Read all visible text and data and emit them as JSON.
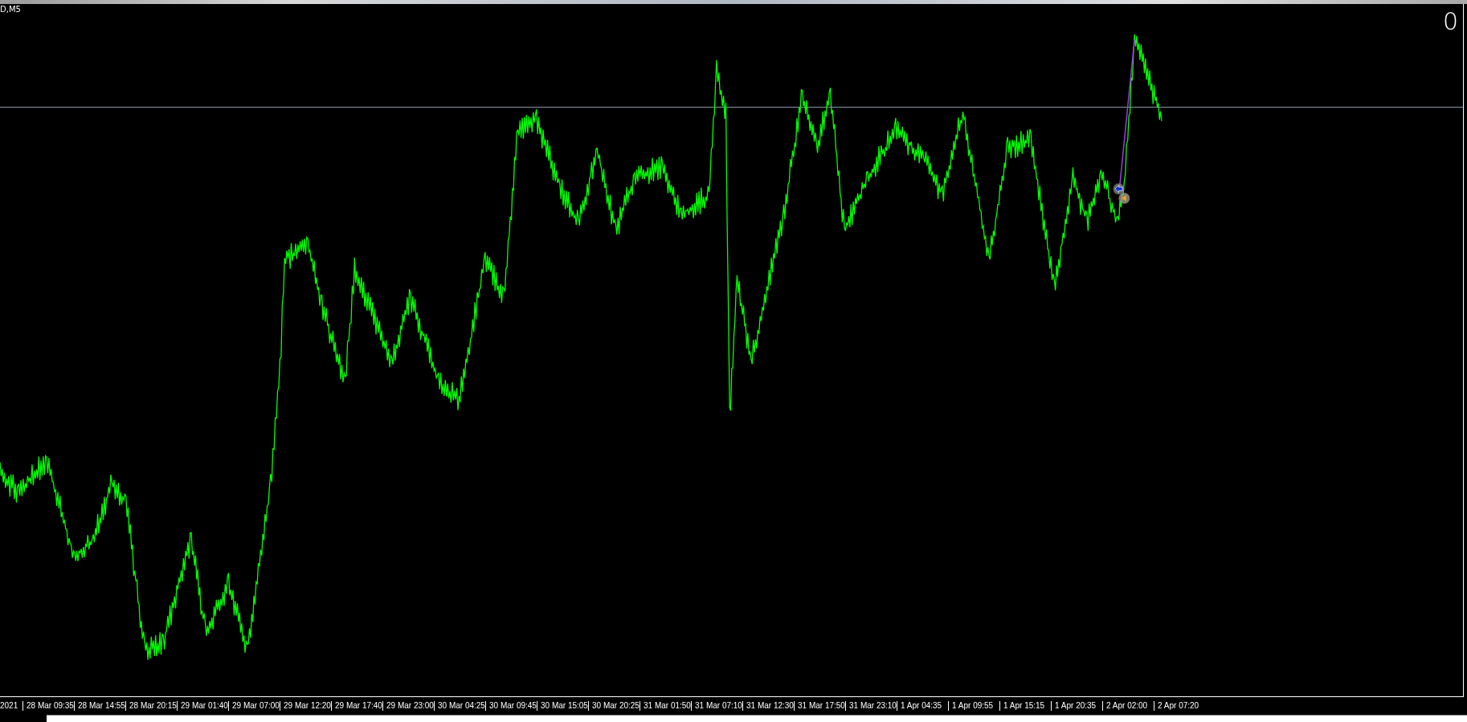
{
  "chart": {
    "symbol_label": "D,M5",
    "corner_label": "0",
    "time_axis": {
      "labels": [
        "2021",
        "28 Mar 09:35",
        "28 Mar 14:55",
        "28 Mar 20:15",
        "29 Mar 01:40",
        "29 Mar 07:00",
        "29 Mar 12:20",
        "29 Mar 17:40",
        "29 Mar 23:00",
        "30 Mar 04:25",
        "30 Mar 09:45",
        "30 Mar 15:05",
        "30 Mar 20:25",
        "31 Mar 01:50",
        "31 Mar 07:10",
        "31 Mar 12:30",
        "31 Mar 17:50",
        "31 Mar 23:10",
        "1 Apr 04:35",
        "1 Apr 09:55",
        "1 Apr 15:15",
        "1 Apr 20:35",
        "2 Apr 02:00",
        "2 Apr 07:20"
      ]
    }
  }
}
